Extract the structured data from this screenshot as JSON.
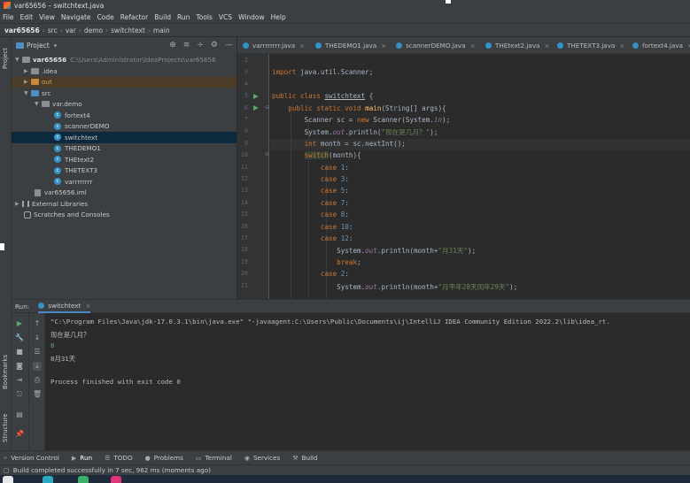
{
  "window": {
    "title": "var65656 – switchtext.java"
  },
  "menu": [
    "File",
    "Edit",
    "View",
    "Navigate",
    "Code",
    "Refactor",
    "Build",
    "Run",
    "Tools",
    "VCS",
    "Window",
    "Help"
  ],
  "breadcrumb": [
    "var65656",
    "src",
    "var",
    "demo",
    "switchtext",
    "main"
  ],
  "left_strip": {
    "project_label": "Project",
    "bookmarks_label": "Bookmarks",
    "structure_label": "Structure"
  },
  "project": {
    "header": "Project",
    "tree": {
      "root_name": "var65656",
      "root_path": "C:\\Users\\Administrator\\IdeaProjects\\var65656",
      "idea": ".idea",
      "out": "out",
      "src": "src",
      "package": "var.demo",
      "classes": [
        "fortext4",
        "scannerDEMO",
        "switchtext",
        "THEDEMO1",
        "THEtext2",
        "THETEXT3",
        "varrrrrrrr"
      ],
      "iml": "var65656.iml",
      "external": "External Libraries",
      "scratches": "Scratches and Consoles"
    }
  },
  "tabs": [
    "varrrrrrrr.java",
    "THEDEMO1.java",
    "scannerDEMO.java",
    "THEtext2.java",
    "THETEXT3.java",
    "fortext4.java"
  ],
  "editor": {
    "line_numbers": [
      "2",
      "3",
      "4",
      "5",
      "6",
      "7",
      "8",
      "9",
      "10",
      "11",
      "12",
      "13",
      "14",
      "15",
      "16",
      "17",
      "18",
      "19",
      "20",
      "21"
    ],
    "code": {
      "l3_kw": "import",
      "l3_rest": " java.util.Scanner;",
      "l5_kw": "public class ",
      "l5_cls": "switchtext",
      "l5_rest": " {",
      "l6_kw": "public static void ",
      "l6_fn": "main",
      "l6_rest": "(String[] args){",
      "l7_a": "Scanner sc = ",
      "l7_kw": "new",
      "l7_b": " Scanner(System.",
      "l7_fld": "in",
      "l7_c": ");",
      "l8_a": "System.",
      "l8_fld": "out",
      "l8_b": ".println(",
      "l8_str": "\"现在是几月？\"",
      "l8_c": ");",
      "l9_kw": "int",
      "l9_rest": " month = sc.nextInt();",
      "l10_kw": "switch",
      "l10_rest": "(month){",
      "case_kw": "case ",
      "case_vals": [
        "1",
        "3",
        "5",
        "7",
        "8",
        "10",
        "12"
      ],
      "colon": ":",
      "l18_a": "System.",
      "l18_fld": "out",
      "l18_b": ".println(month+",
      "l18_str": "\"月31天\"",
      "l18_c": ");",
      "l19_kw": "break",
      "l19_rest": ";",
      "l20_val": "2",
      "l21_a": "System.",
      "l21_fld": "out",
      "l21_b": ".println(month+",
      "l21_str": "\"月平年28天闰年29天\"",
      "l21_c": ");"
    }
  },
  "run": {
    "label": "Run:",
    "tab": "switchtext",
    "output": {
      "cmd": "\"C:\\Program Files\\Java\\jdk-17.0.3.1\\bin\\java.exe\" \"-javaagent:C:\\Users\\Public\\Documents\\ij\\IntelliJ IDEA Community Edition 2022.2\\lib\\idea_rt.",
      "prompt": "现在是几月？",
      "input": "8",
      "result": "8月31天",
      "finish": "Process finished with exit code 0"
    }
  },
  "bottom_tabs": [
    "Version Control",
    "Run",
    "TODO",
    "Problems",
    "Terminal",
    "Services",
    "Build"
  ],
  "status": {
    "message": "Build completed successfully in 7 sec, 962 ms (moments ago)"
  },
  "colors": {
    "background": "#2b2b2b",
    "panel": "#3c3f41",
    "keyword": "#cc7832",
    "string": "#6a8759",
    "selection": "#0d293e"
  }
}
